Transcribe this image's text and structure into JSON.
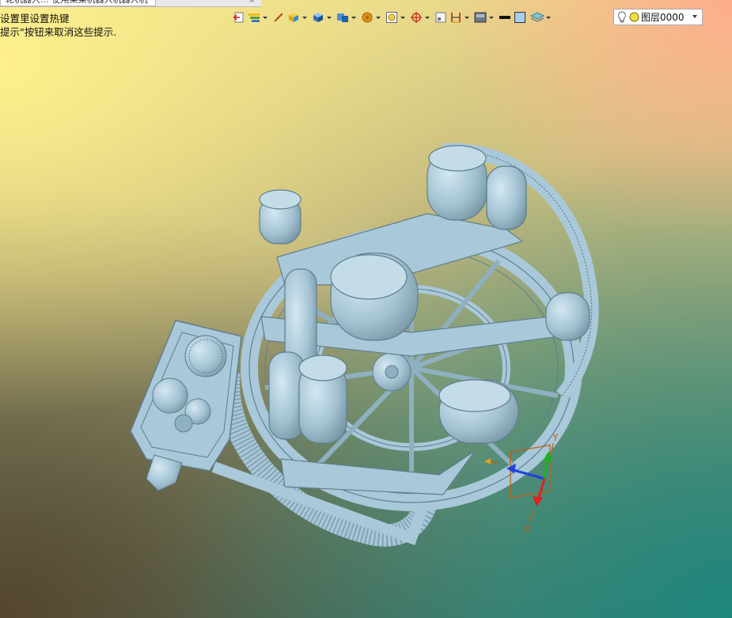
{
  "window": {
    "tab_title": "轮机器人…“使用某某机器人机器人机”",
    "tab_close": "×"
  },
  "hints": {
    "line1": "设置里设置热键",
    "line2": "提示\"按钮来取消这些提示."
  },
  "toolbar": {
    "items": [
      {
        "name": "exit-sketch-icon"
      },
      {
        "name": "feature-stack-icon",
        "dropdown": true
      },
      {
        "name": "pencil-icon"
      },
      {
        "name": "box-shaded-icon",
        "dropdown": true
      },
      {
        "name": "cube-blue-icon",
        "dropdown": true
      },
      {
        "name": "cube-view-icon",
        "dropdown": true
      },
      {
        "name": "render-mode-icon",
        "dropdown": true
      },
      {
        "name": "zoom-fit-icon",
        "dropdown": true
      },
      {
        "name": "snap-target-icon",
        "dropdown": true
      },
      {
        "name": "blank-page-icon"
      },
      {
        "name": "section-plane-icon",
        "dropdown": true
      },
      {
        "name": "background-icon",
        "dropdown": true
      },
      {
        "name": "line-color-icon"
      },
      {
        "name": "face-color-icon"
      },
      {
        "name": "layers-icon",
        "dropdown": true
      }
    ]
  },
  "layer_select": {
    "value": "图层0000",
    "icon_bulb": "lightbulb-icon",
    "icon_dot": "layer-color-icon"
  },
  "triad": {
    "y_label": "Y",
    "x_label": "X",
    "colors": {
      "x": "#e02020",
      "y": "#20b020",
      "z": "#2040e0",
      "box": "#c06010"
    }
  },
  "model": {
    "color": "#a9c8d9",
    "edge": "#5f7e8e"
  }
}
